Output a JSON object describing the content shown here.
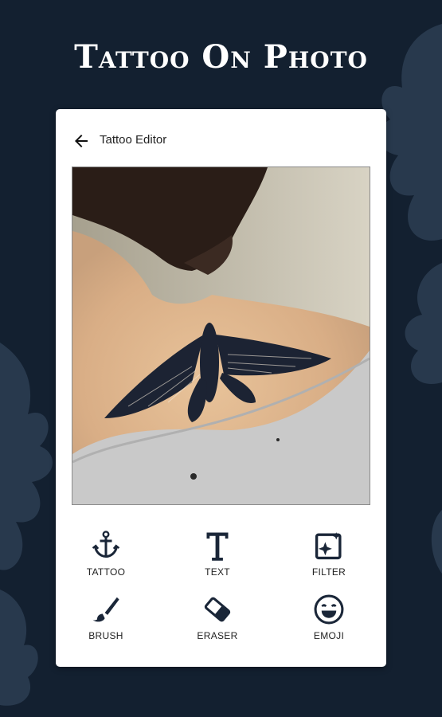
{
  "app": {
    "headline": "Tattoo On Photo"
  },
  "editor": {
    "title": "Tattoo Editor",
    "tools": [
      {
        "label": "TATTOO",
        "icon": "anchor-icon"
      },
      {
        "label": "TEXT",
        "icon": "text-t-icon"
      },
      {
        "label": "FILTER",
        "icon": "filter-sparkle-icon"
      },
      {
        "label": "BRUSH",
        "icon": "brush-icon"
      },
      {
        "label": "ERASER",
        "icon": "eraser-icon"
      },
      {
        "label": "EMOJI",
        "icon": "emoji-icon"
      }
    ]
  },
  "colors": {
    "background": "#132030",
    "card": "#ffffff",
    "ink": "#1a2638"
  }
}
